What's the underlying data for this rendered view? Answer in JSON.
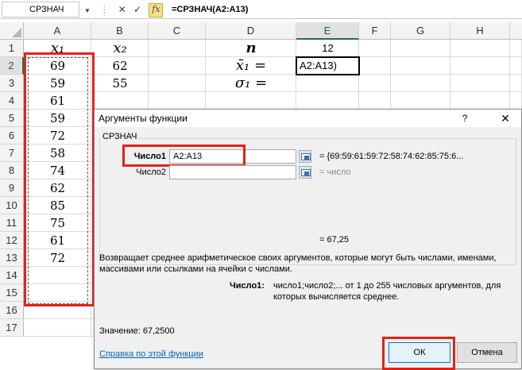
{
  "formula_bar": {
    "name_box": "СРЗНАЧ",
    "cancel_symbol": "✕",
    "enter_symbol": "✓",
    "fx_label": "fx",
    "formula": "=СРЗНАЧ(A2:A13)"
  },
  "columns": [
    "A",
    "B",
    "C",
    "D",
    "E",
    "F",
    "G",
    "H"
  ],
  "rows": [
    "1",
    "2",
    "3",
    "4",
    "5",
    "6",
    "7",
    "8",
    "9",
    "10",
    "11",
    "12",
    "13",
    "14",
    "15",
    "16",
    "17"
  ],
  "cells": {
    "A1": "x₁",
    "B1": "x₂",
    "D1": "n",
    "E1": "12",
    "D2": "x̄₁ =",
    "E2": "A2:A13)",
    "D3": "σ₁ =",
    "col_a": [
      "69",
      "59",
      "61",
      "59",
      "72",
      "58",
      "74",
      "62",
      "85",
      "75",
      "61",
      "72"
    ],
    "col_b": [
      "62",
      "55"
    ]
  },
  "dialog": {
    "title": "Аргументы функции",
    "help_symbol": "?",
    "close_symbol": "✕",
    "function_name": "СРЗНАЧ",
    "arg1_label": "Число1",
    "arg1_value": "A2:A13",
    "arg1_result": "=  {69:59:61:59:72:58:74:62:85:75:6...",
    "arg2_label": "Число2",
    "arg2_value": "",
    "arg2_result": "=  число",
    "result": "=  67,25",
    "description": "Возвращает среднее арифметическое своих аргументов, которые могут быть числами, именами, массивами или ссылками на ячейки с числами.",
    "arg_help_label": "Число1:",
    "arg_help_text": "число1;число2;... от 1 до 255 числовых аргументов, для которых вычисляется среднее.",
    "value_text": "Значение:  67,2500",
    "help_link": "Справка по этой функции",
    "ok_label": "ОК",
    "cancel_label": "Отмена"
  },
  "colors": {
    "highlight_red": "#e2231a",
    "excel_green": "#217346"
  }
}
